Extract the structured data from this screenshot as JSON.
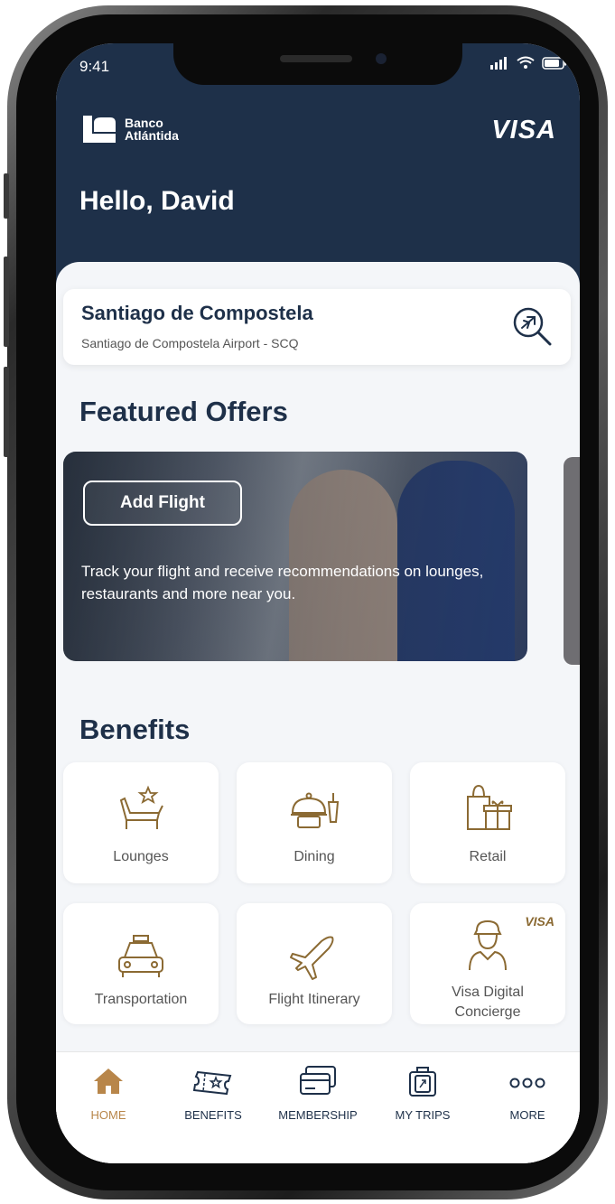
{
  "status_bar": {
    "time": "9:41"
  },
  "brand": {
    "logo_line1": "Banco",
    "logo_line2": "Atlántida",
    "card_network": "VISA"
  },
  "greeting": "Hello, David",
  "search": {
    "title": "Santiago de Compostela",
    "subtitle": "Santiago de Compostela Airport - SCQ",
    "icon": "airplane-search-icon"
  },
  "featured": {
    "title": "Featured Offers",
    "card": {
      "button_label": "Add Flight",
      "description": "Track your flight and receive recommendations on lounges, restaurants and more near you."
    }
  },
  "benefits": {
    "title": "Benefits",
    "badge": "VISA",
    "items": [
      {
        "label": "Lounges",
        "icon": "lounge-icon"
      },
      {
        "label": "Dining",
        "icon": "dining-icon"
      },
      {
        "label": "Retail",
        "icon": "shopping-gift-icon"
      },
      {
        "label": "Transportation",
        "icon": "taxi-icon"
      },
      {
        "label": "Flight Itinerary",
        "icon": "airplane-icon"
      },
      {
        "label": "Visa Digital Concierge",
        "icon": "concierge-icon"
      }
    ]
  },
  "nav": {
    "items": [
      {
        "label": "HOME",
        "icon": "home-icon",
        "active": true
      },
      {
        "label": "BENEFITS",
        "icon": "ticket-icon",
        "active": false
      },
      {
        "label": "MEMBERSHIP",
        "icon": "cards-icon",
        "active": false
      },
      {
        "label": "MY TRIPS",
        "icon": "luggage-icon",
        "active": false
      },
      {
        "label": "MORE",
        "icon": "more-dots-icon",
        "active": false
      }
    ]
  },
  "colors": {
    "navy": "#1e3049",
    "gold": "#b8864a",
    "icon_line": "#8b6a33"
  }
}
